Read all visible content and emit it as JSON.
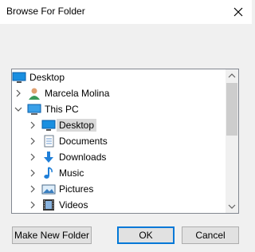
{
  "window": {
    "title": "Browse For Folder"
  },
  "tree": {
    "items": [
      {
        "label": "Desktop",
        "icon": "desktop-icon",
        "expander": "none"
      },
      {
        "label": "Marcela Molina",
        "icon": "user-icon",
        "expander": "collapsed"
      },
      {
        "label": "This PC",
        "icon": "pc-icon",
        "expander": "expanded"
      },
      {
        "label": "Desktop",
        "icon": "desktop-icon",
        "expander": "collapsed",
        "selected": true
      },
      {
        "label": "Documents",
        "icon": "documents-icon",
        "expander": "collapsed"
      },
      {
        "label": "Downloads",
        "icon": "downloads-icon",
        "expander": "collapsed"
      },
      {
        "label": "Music",
        "icon": "music-icon",
        "expander": "collapsed"
      },
      {
        "label": "Pictures",
        "icon": "pictures-icon",
        "expander": "collapsed"
      },
      {
        "label": "Videos",
        "icon": "videos-icon",
        "expander": "collapsed"
      }
    ]
  },
  "buttons": {
    "new_folder": "Make New Folder",
    "ok": "OK",
    "cancel": "Cancel"
  },
  "colors": {
    "accent": "#0078d7",
    "selection": "#d9d9d9"
  }
}
